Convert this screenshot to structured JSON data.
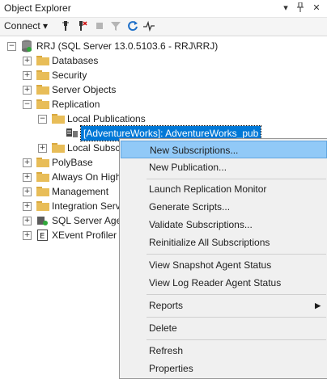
{
  "window": {
    "title": "Object Explorer"
  },
  "titlebar_buttons": {
    "dropdown": "▾",
    "pin": "📌",
    "close": "✕"
  },
  "toolbar": {
    "connect_label": "Connect",
    "connect_arrow": "▾"
  },
  "tree": {
    "server": "RRJ (SQL Server 13.0.5103.6 - RRJ\\RRJ)",
    "databases": "Databases",
    "security": "Security",
    "server_objects": "Server Objects",
    "replication": "Replication",
    "local_publications": "Local Publications",
    "publication": "[AdventureWorks]: AdventureWorks_pub",
    "local_subscriptions": "Local Subsc",
    "polybase": "PolyBase",
    "always_on": "Always On High",
    "management": "Management",
    "integration": "Integration Serv",
    "agent": "SQL Server Agen",
    "xevent": "XEvent Profiler"
  },
  "context_menu": {
    "items": [
      "New Subscriptions...",
      "New Publication...",
      "Launch Replication Monitor",
      "Generate Scripts...",
      "Validate Subscriptions...",
      "Reinitialize All Subscriptions",
      "View Snapshot Agent Status",
      "View Log Reader Agent Status",
      "Reports",
      "Delete",
      "Refresh",
      "Properties"
    ],
    "submenu_arrow": "▶"
  },
  "colors": {
    "selection": "#0078d7",
    "menu_highlight": "#91c9f7",
    "folder": "#e8bd58"
  }
}
